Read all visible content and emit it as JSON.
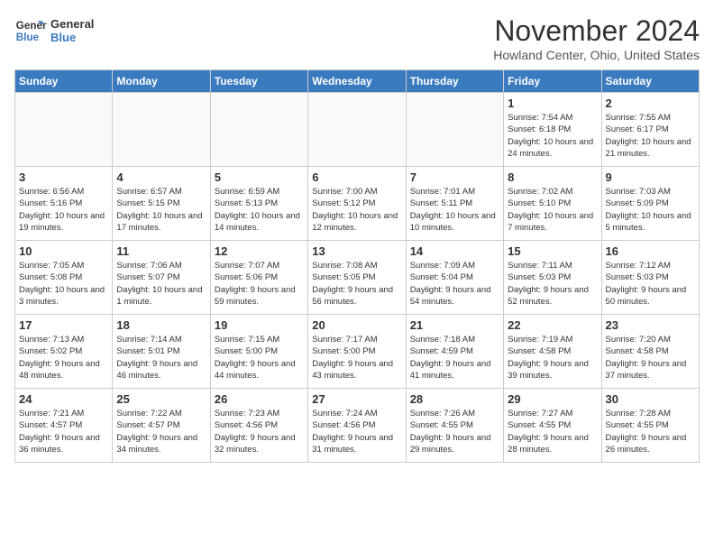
{
  "logo": {
    "line1": "General",
    "line2": "Blue"
  },
  "title": "November 2024",
  "location": "Howland Center, Ohio, United States",
  "weekdays": [
    "Sunday",
    "Monday",
    "Tuesday",
    "Wednesday",
    "Thursday",
    "Friday",
    "Saturday"
  ],
  "weeks": [
    [
      {
        "day": "",
        "info": ""
      },
      {
        "day": "",
        "info": ""
      },
      {
        "day": "",
        "info": ""
      },
      {
        "day": "",
        "info": ""
      },
      {
        "day": "",
        "info": ""
      },
      {
        "day": "1",
        "info": "Sunrise: 7:54 AM\nSunset: 6:18 PM\nDaylight: 10 hours and 24 minutes."
      },
      {
        "day": "2",
        "info": "Sunrise: 7:55 AM\nSunset: 6:17 PM\nDaylight: 10 hours and 21 minutes."
      }
    ],
    [
      {
        "day": "3",
        "info": "Sunrise: 6:56 AM\nSunset: 5:16 PM\nDaylight: 10 hours and 19 minutes."
      },
      {
        "day": "4",
        "info": "Sunrise: 6:57 AM\nSunset: 5:15 PM\nDaylight: 10 hours and 17 minutes."
      },
      {
        "day": "5",
        "info": "Sunrise: 6:59 AM\nSunset: 5:13 PM\nDaylight: 10 hours and 14 minutes."
      },
      {
        "day": "6",
        "info": "Sunrise: 7:00 AM\nSunset: 5:12 PM\nDaylight: 10 hours and 12 minutes."
      },
      {
        "day": "7",
        "info": "Sunrise: 7:01 AM\nSunset: 5:11 PM\nDaylight: 10 hours and 10 minutes."
      },
      {
        "day": "8",
        "info": "Sunrise: 7:02 AM\nSunset: 5:10 PM\nDaylight: 10 hours and 7 minutes."
      },
      {
        "day": "9",
        "info": "Sunrise: 7:03 AM\nSunset: 5:09 PM\nDaylight: 10 hours and 5 minutes."
      }
    ],
    [
      {
        "day": "10",
        "info": "Sunrise: 7:05 AM\nSunset: 5:08 PM\nDaylight: 10 hours and 3 minutes."
      },
      {
        "day": "11",
        "info": "Sunrise: 7:06 AM\nSunset: 5:07 PM\nDaylight: 10 hours and 1 minute."
      },
      {
        "day": "12",
        "info": "Sunrise: 7:07 AM\nSunset: 5:06 PM\nDaylight: 9 hours and 59 minutes."
      },
      {
        "day": "13",
        "info": "Sunrise: 7:08 AM\nSunset: 5:05 PM\nDaylight: 9 hours and 56 minutes."
      },
      {
        "day": "14",
        "info": "Sunrise: 7:09 AM\nSunset: 5:04 PM\nDaylight: 9 hours and 54 minutes."
      },
      {
        "day": "15",
        "info": "Sunrise: 7:11 AM\nSunset: 5:03 PM\nDaylight: 9 hours and 52 minutes."
      },
      {
        "day": "16",
        "info": "Sunrise: 7:12 AM\nSunset: 5:03 PM\nDaylight: 9 hours and 50 minutes."
      }
    ],
    [
      {
        "day": "17",
        "info": "Sunrise: 7:13 AM\nSunset: 5:02 PM\nDaylight: 9 hours and 48 minutes."
      },
      {
        "day": "18",
        "info": "Sunrise: 7:14 AM\nSunset: 5:01 PM\nDaylight: 9 hours and 46 minutes."
      },
      {
        "day": "19",
        "info": "Sunrise: 7:15 AM\nSunset: 5:00 PM\nDaylight: 9 hours and 44 minutes."
      },
      {
        "day": "20",
        "info": "Sunrise: 7:17 AM\nSunset: 5:00 PM\nDaylight: 9 hours and 43 minutes."
      },
      {
        "day": "21",
        "info": "Sunrise: 7:18 AM\nSunset: 4:59 PM\nDaylight: 9 hours and 41 minutes."
      },
      {
        "day": "22",
        "info": "Sunrise: 7:19 AM\nSunset: 4:58 PM\nDaylight: 9 hours and 39 minutes."
      },
      {
        "day": "23",
        "info": "Sunrise: 7:20 AM\nSunset: 4:58 PM\nDaylight: 9 hours and 37 minutes."
      }
    ],
    [
      {
        "day": "24",
        "info": "Sunrise: 7:21 AM\nSunset: 4:57 PM\nDaylight: 9 hours and 36 minutes."
      },
      {
        "day": "25",
        "info": "Sunrise: 7:22 AM\nSunset: 4:57 PM\nDaylight: 9 hours and 34 minutes."
      },
      {
        "day": "26",
        "info": "Sunrise: 7:23 AM\nSunset: 4:56 PM\nDaylight: 9 hours and 32 minutes."
      },
      {
        "day": "27",
        "info": "Sunrise: 7:24 AM\nSunset: 4:56 PM\nDaylight: 9 hours and 31 minutes."
      },
      {
        "day": "28",
        "info": "Sunrise: 7:26 AM\nSunset: 4:55 PM\nDaylight: 9 hours and 29 minutes."
      },
      {
        "day": "29",
        "info": "Sunrise: 7:27 AM\nSunset: 4:55 PM\nDaylight: 9 hours and 28 minutes."
      },
      {
        "day": "30",
        "info": "Sunrise: 7:28 AM\nSunset: 4:55 PM\nDaylight: 9 hours and 26 minutes."
      }
    ]
  ]
}
